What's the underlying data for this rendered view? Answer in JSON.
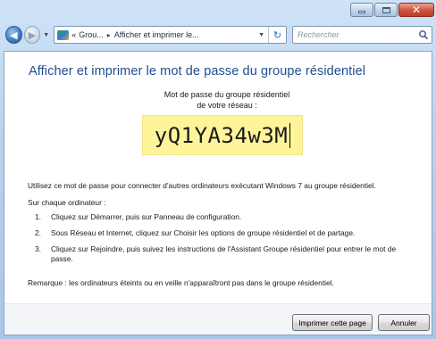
{
  "window": {
    "title": "",
    "caption_buttons": [
      "minimize",
      "maximize",
      "close"
    ]
  },
  "navbar": {
    "breadcrumb": {
      "prefix": "«",
      "parent": "Grou...",
      "separator": "▸",
      "current": "Afficher et imprimer le..."
    },
    "search_placeholder": "Rechercher",
    "icons": [
      "back-arrow-icon",
      "forward-arrow-icon",
      "homegroup-icon",
      "refresh-icon",
      "search-icon"
    ]
  },
  "content": {
    "title": "Afficher et imprimer le mot de passe du groupe résidentiel",
    "password_label_line1": "Mot de passe du groupe résidentiel",
    "password_label_line2": "de votre réseau :",
    "password": "yQ1YA34w3M",
    "intro": "Utilisez ce mot de passe pour connecter d'autres ordinateurs exécutant Windows 7 au groupe résidentiel.",
    "each_computer": "Sur chaque ordinateur :",
    "steps": [
      {
        "num": "1.",
        "text": "Cliquez sur Démarrer, puis sur Panneau de configuration."
      },
      {
        "num": "2.",
        "text": "Sous Réseau et Internet, cliquez sur Choisir les options de groupe résidentiel et de partage."
      },
      {
        "num": "3.",
        "text": "Cliquez sur Rejoindre, puis suivez les instructions de l'Assistant Groupe résidentiel pour entrer le mot de passe."
      }
    ],
    "note": "Remarque : les ordinateurs éteints ou en veille n'apparaîtront pas dans le groupe résidentiel."
  },
  "footer": {
    "print_label": "Imprimer cette page",
    "cancel_label": "Annuler"
  },
  "colors": {
    "title_blue": "#1f4e94",
    "password_highlight": "#fff49a",
    "chrome": "#b9d3ee",
    "close_button": "#c0392b"
  }
}
